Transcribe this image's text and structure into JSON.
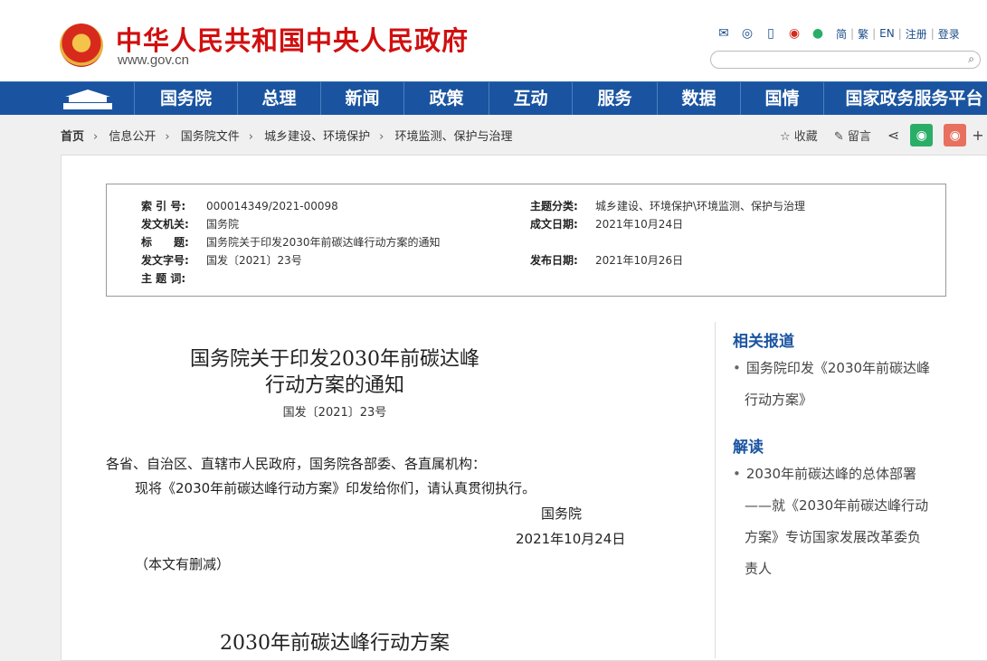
{
  "header": {
    "title": "中华人民共和国中央人民政府",
    "domain": "www.gov.cn",
    "links": [
      "简",
      "繁",
      "EN",
      "注册",
      "登录"
    ]
  },
  "nav": [
    "国务院",
    "总理",
    "新闻",
    "政策",
    "互动",
    "服务",
    "数据",
    "国情",
    "国家政务服务平台"
  ],
  "breadcrumb": [
    "首页",
    "信息公开",
    "国务院文件",
    "城乡建设、环境保护",
    "环境监测、保护与治理"
  ],
  "share": {
    "favorite": "收藏",
    "comment": "留言"
  },
  "meta": {
    "index_label": "索 引 号:",
    "index": "000014349/2021-00098",
    "category_label": "主题分类:",
    "category": "城乡建设、环境保护\\环境监测、保护与治理",
    "issuer_label": "发文机关:",
    "issuer": "国务院",
    "date_made_label": "成文日期:",
    "date_made": "2021年10月24日",
    "title_label": "标　　题:",
    "title": "国务院关于印发2030年前碳达峰行动方案的通知",
    "doc_num_label": "发文字号:",
    "doc_num": "国发〔2021〕23号",
    "pub_date_label": "发布日期:",
    "pub_date": "2021年10月26日",
    "keywords_label": "主 题 词:"
  },
  "article": {
    "title_line1": "国务院关于印发2030年前碳达峰",
    "title_line2": "行动方案的通知",
    "doc_num": "国发〔2021〕23号",
    "salutation": "各省、自治区、直辖市人民政府，国务院各部委、各直属机构：",
    "body": "现将《2030年前碳达峰行动方案》印发给你们，请认真贯彻执行。",
    "sign": "国务院",
    "date": "2021年10月24日",
    "note": "（本文有删减）",
    "plan_title": "2030年前碳达峰行动方案"
  },
  "sidebar": {
    "related_title": "相关报道",
    "related_1a": "国务院印发《2030年前碳达峰",
    "related_1b": "行动方案》",
    "interpret_title": "解读",
    "interp_1a": "2030年前碳达峰的总体部署",
    "interp_1b": "——就《2030年前碳达峰行动",
    "interp_1c": "方案》专访国家发展改革委负",
    "interp_1d": "责人"
  },
  "colors": {
    "nav_bg": "#1a54a0",
    "title_red": "#d10f0f",
    "link_blue": "#1a54a0"
  }
}
